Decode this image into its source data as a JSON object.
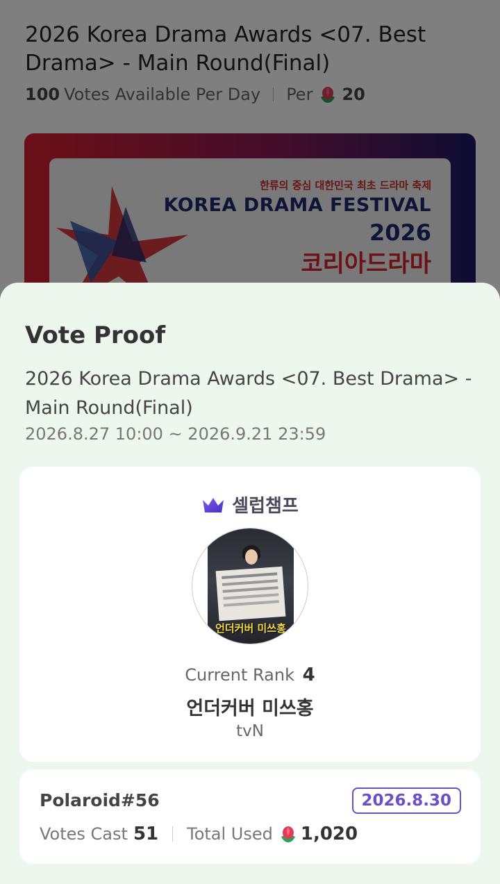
{
  "background": {
    "title": "2026 Korea Drama Awards <07. Best Drama> - Main Round(Final)",
    "votes_per_day": "100",
    "votes_label": "Votes Available Per Day",
    "per_label": "Per",
    "per_value": "20",
    "banner": {
      "tagline": "한류의 중심 대한민국 최초 드라마 축제",
      "festival": "KOREA DRAMA FESTIVAL",
      "year": "2026",
      "korean_title": "코리아드라마"
    }
  },
  "sheet": {
    "title": "Vote Proof",
    "event": "2026 Korea Drama Awards <07. Best Drama> - Main Round(Final)",
    "period": "2026.8.27 10:00 ~ 2026.9.21 23:59"
  },
  "nominee_card": {
    "brand": "셀럽챔프",
    "poster_title": "언더커버 미쓰홍",
    "rank_label": "Current Rank",
    "rank_value": "4",
    "name": "언더커버 미쓰홍",
    "network": "tvN"
  },
  "proof_card": {
    "id": "Polaroid#56",
    "date": "2026.8.30",
    "votes_cast_label": "Votes Cast",
    "votes_cast_value": "51",
    "total_used_label": "Total Used",
    "total_used_value": "1,020"
  },
  "colors": {
    "sheet_bg": "#edf7ee",
    "accent_purple": "#6a4fc7",
    "flower_red": "#e23b5a"
  },
  "icons": {
    "vote_currency": "flower-icon",
    "brand": "crown-icon"
  }
}
